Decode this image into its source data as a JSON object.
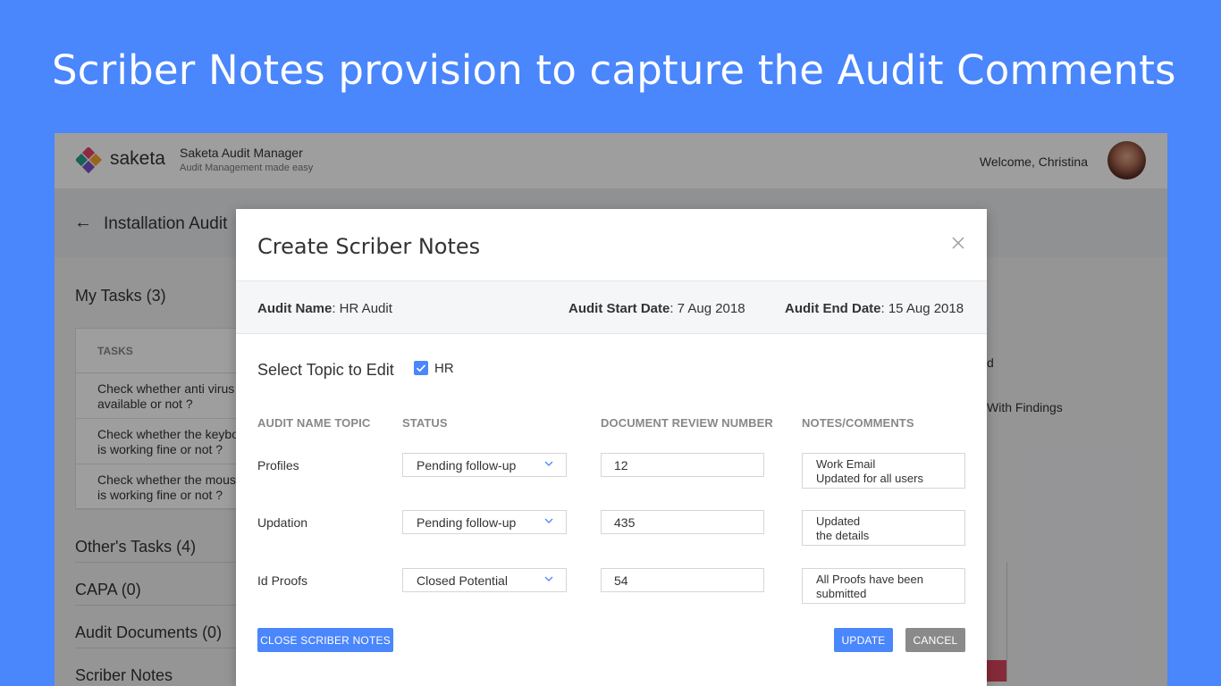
{
  "slide": {
    "title": "Scriber Notes provision to capture the Audit Comments"
  },
  "app": {
    "logo_text": "saketa",
    "name": "Saketa Audit Manager",
    "tagline": "Audit Management made easy",
    "welcome": "Welcome, Christina",
    "audit_title": "Installation Audit"
  },
  "left_pane": {
    "my_tasks": "My Tasks (3)",
    "tasks_header": "TASKS",
    "tasks": [
      "Check whether anti virus\navailable or not ?",
      "Check whether the keybo\nis working fine or not ?",
      "Check whether the mouse\nis working fine or not ?"
    ],
    "sections": [
      "Other's Tasks (4)",
      "CAPA (0)",
      "Audit Documents (0)",
      "Scriber Notes"
    ]
  },
  "right_fragments": [
    "d",
    "With Findings"
  ],
  "modal": {
    "title": "Create Scriber Notes",
    "audit_name_label": "Audit Name",
    "audit_name_value": ": HR Audit",
    "start_label": "Audit Start Date",
    "start_value": ": 7 Aug 2018",
    "end_label": "Audit End Date",
    "end_value": ": 15 Aug 2018",
    "select_topic_label": "Select Topic to Edit",
    "topic_checkbox_label": "HR",
    "columns": [
      "AUDIT NAME TOPIC",
      "STATUS",
      "DOCUMENT REVIEW NUMBER",
      "NOTES/COMMENTS"
    ],
    "rows": [
      {
        "topic": "Profiles",
        "status": "Pending follow-up",
        "review_number": "12",
        "notes": "Work Email\nUpdated for all users"
      },
      {
        "topic": "Updation",
        "status": "Pending follow-up",
        "review_number": "435",
        "notes": "Updated\nthe details"
      },
      {
        "topic": "Id Proofs",
        "status": "Closed Potential",
        "review_number": "54",
        "notes": "All Proofs have been\nsubmitted"
      }
    ],
    "close_notes_button": "CLOSE SCRIBER NOTES",
    "update_button": "UPDATE",
    "cancel_button": "CANCEL"
  },
  "colors": {
    "accent": "#4a86fc",
    "cancel": "#8a8a8a",
    "chart_bar": "#d9455c"
  }
}
